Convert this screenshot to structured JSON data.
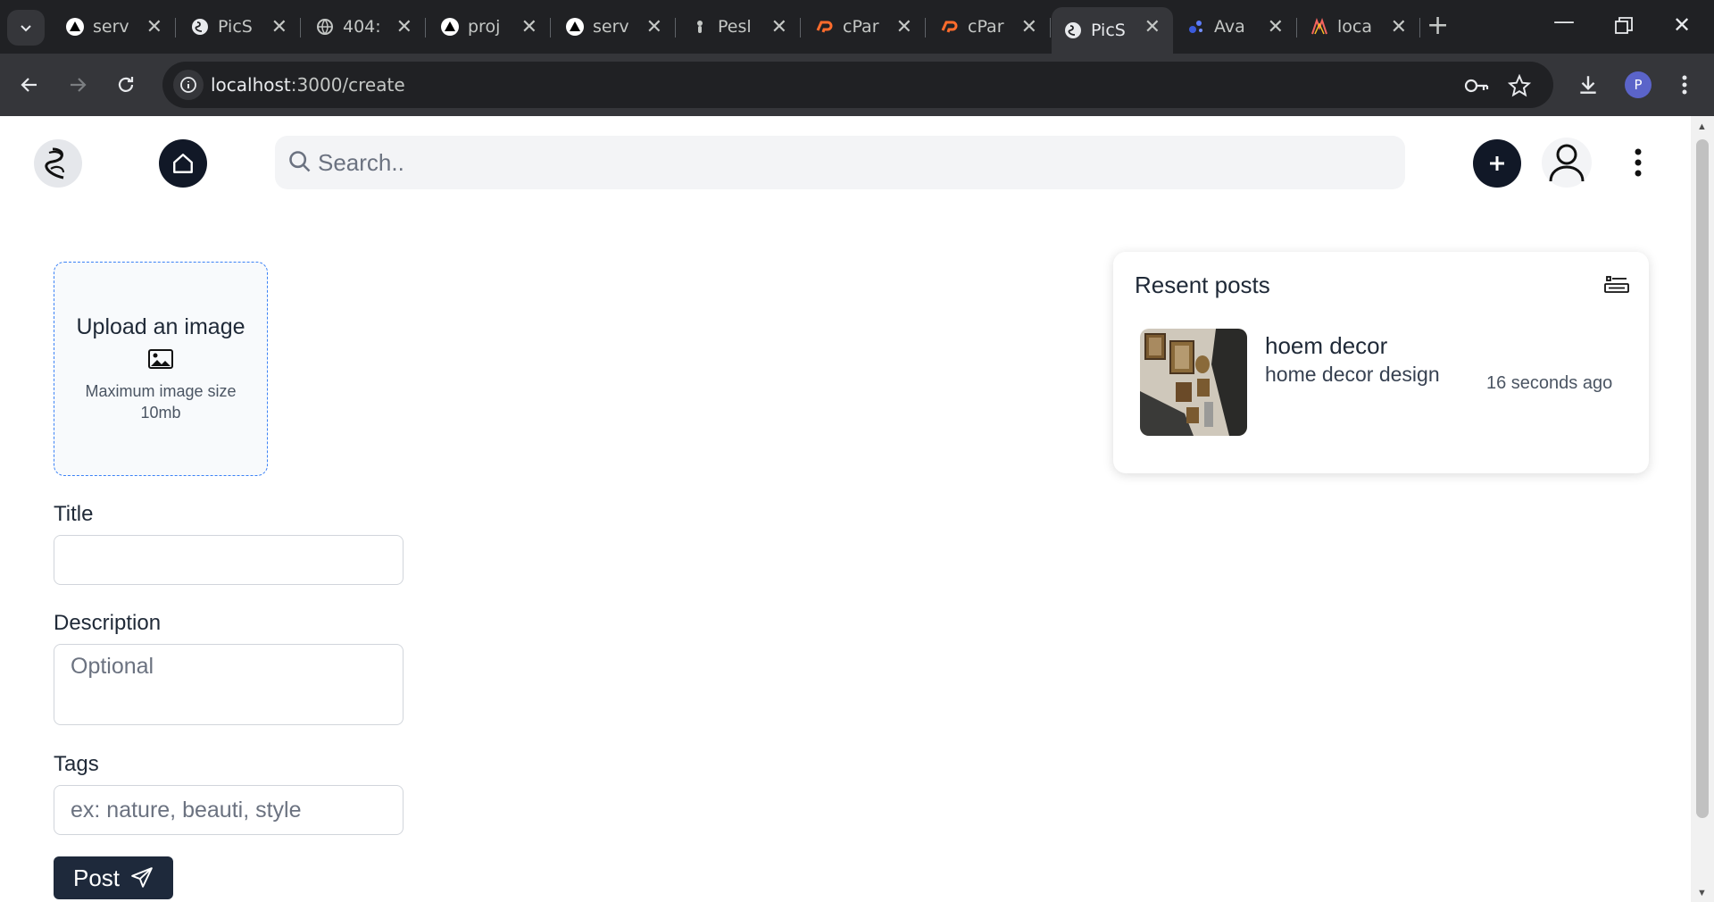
{
  "browser": {
    "tabs": [
      {
        "title": "serv",
        "favicon": "triangle-icon"
      },
      {
        "title": "PicS",
        "favicon": "picsea-logo-icon"
      },
      {
        "title": "404:",
        "favicon": "globe-icon"
      },
      {
        "title": "proj",
        "favicon": "triangle-icon"
      },
      {
        "title": "serv",
        "favicon": "triangle-icon"
      },
      {
        "title": "Pesl",
        "favicon": "pest-icon"
      },
      {
        "title": "cPar",
        "favicon": "cpanel-icon"
      },
      {
        "title": "cPar",
        "favicon": "cpanel-icon"
      },
      {
        "title": "PicS",
        "favicon": "picsea-logo-icon",
        "active": true
      },
      {
        "title": "Ava",
        "favicon": "avatar-dots-icon"
      },
      {
        "title": "loca",
        "favicon": "laravel-icon"
      }
    ],
    "url_host": "localhost",
    "url_path": ":3000/create",
    "profile_initial": "P"
  },
  "header": {
    "search_placeholder": "Search.."
  },
  "upload": {
    "title": "Upload an image",
    "note": "Maximum image size 10mb"
  },
  "form": {
    "title_label": "Title",
    "title_value": "",
    "description_label": "Description",
    "description_placeholder": "Optional",
    "tags_label": "Tags",
    "tags_placeholder": "ex: nature, beauti, style",
    "post_label": "Post"
  },
  "recent": {
    "title": "Resent posts",
    "items": [
      {
        "title": "hoem decor",
        "description": "home decor design",
        "time": "16 seconds ago"
      }
    ]
  },
  "colors": {
    "dark_button": "#111827",
    "post_button": "#1e293b",
    "upload_border": "#3b82f6",
    "chrome_bg": "#202124",
    "chrome_toolbar": "#35363a"
  }
}
